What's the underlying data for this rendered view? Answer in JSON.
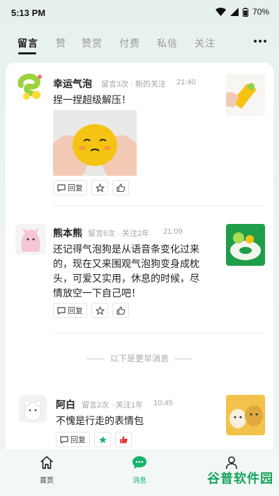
{
  "status": {
    "time": "5:13 PM",
    "battery": "70%"
  },
  "tabs": [
    {
      "label": "留言",
      "active": true
    },
    {
      "label": "赞"
    },
    {
      "label": "赞赏"
    },
    {
      "label": "付费"
    },
    {
      "label": "私信"
    },
    {
      "label": "关注"
    }
  ],
  "messages": [
    {
      "name": "幸运气泡",
      "meta": "留言3次 · 新的关注",
      "time": "21:40",
      "text": "捏一捏超级解压！",
      "reply_label": "回复"
    },
    {
      "name": "熊本熊",
      "meta": "留言6次 · 关注2年",
      "time": "21:09",
      "text": "还记得气泡狗是从语音条变化过来的，现在又来围观气泡狗变身成枕头，可爱又实用，休息的时候，尽情放空一下自己吧！",
      "reply_label": "回复"
    },
    {
      "name": "阿白",
      "meta": "留言2次 · 关注1年",
      "time": "10:45",
      "text": "不愧是行走的表情包",
      "reply_label": "回复"
    }
  ],
  "earlier_divider": "以下是更早消息",
  "bottom_nav": [
    {
      "label": "首页",
      "icon": "home-icon"
    },
    {
      "label": "消息",
      "icon": "message-icon",
      "active": true
    },
    {
      "label": "",
      "icon": "profile-icon"
    }
  ],
  "watermark": "谷普软件园",
  "colors": {
    "accent": "#18b36b",
    "liked": "#e23b3b"
  }
}
